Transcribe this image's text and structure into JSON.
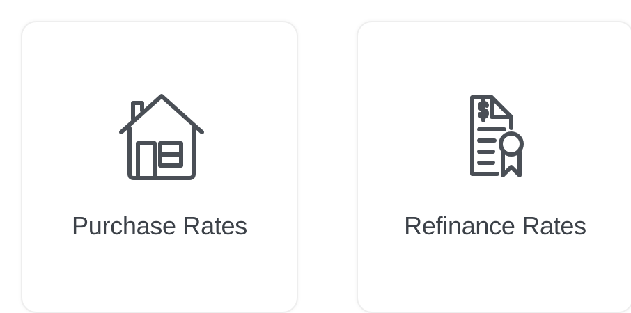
{
  "cards": [
    {
      "label": "Purchase Rates",
      "icon": "house-icon"
    },
    {
      "label": "Refinance Rates",
      "icon": "certificate-document-icon"
    }
  ],
  "colors": {
    "icon_stroke": "#4a4f56",
    "label_text": "#3c4148",
    "card_border": "#eeeeee",
    "background": "#ffffff"
  }
}
